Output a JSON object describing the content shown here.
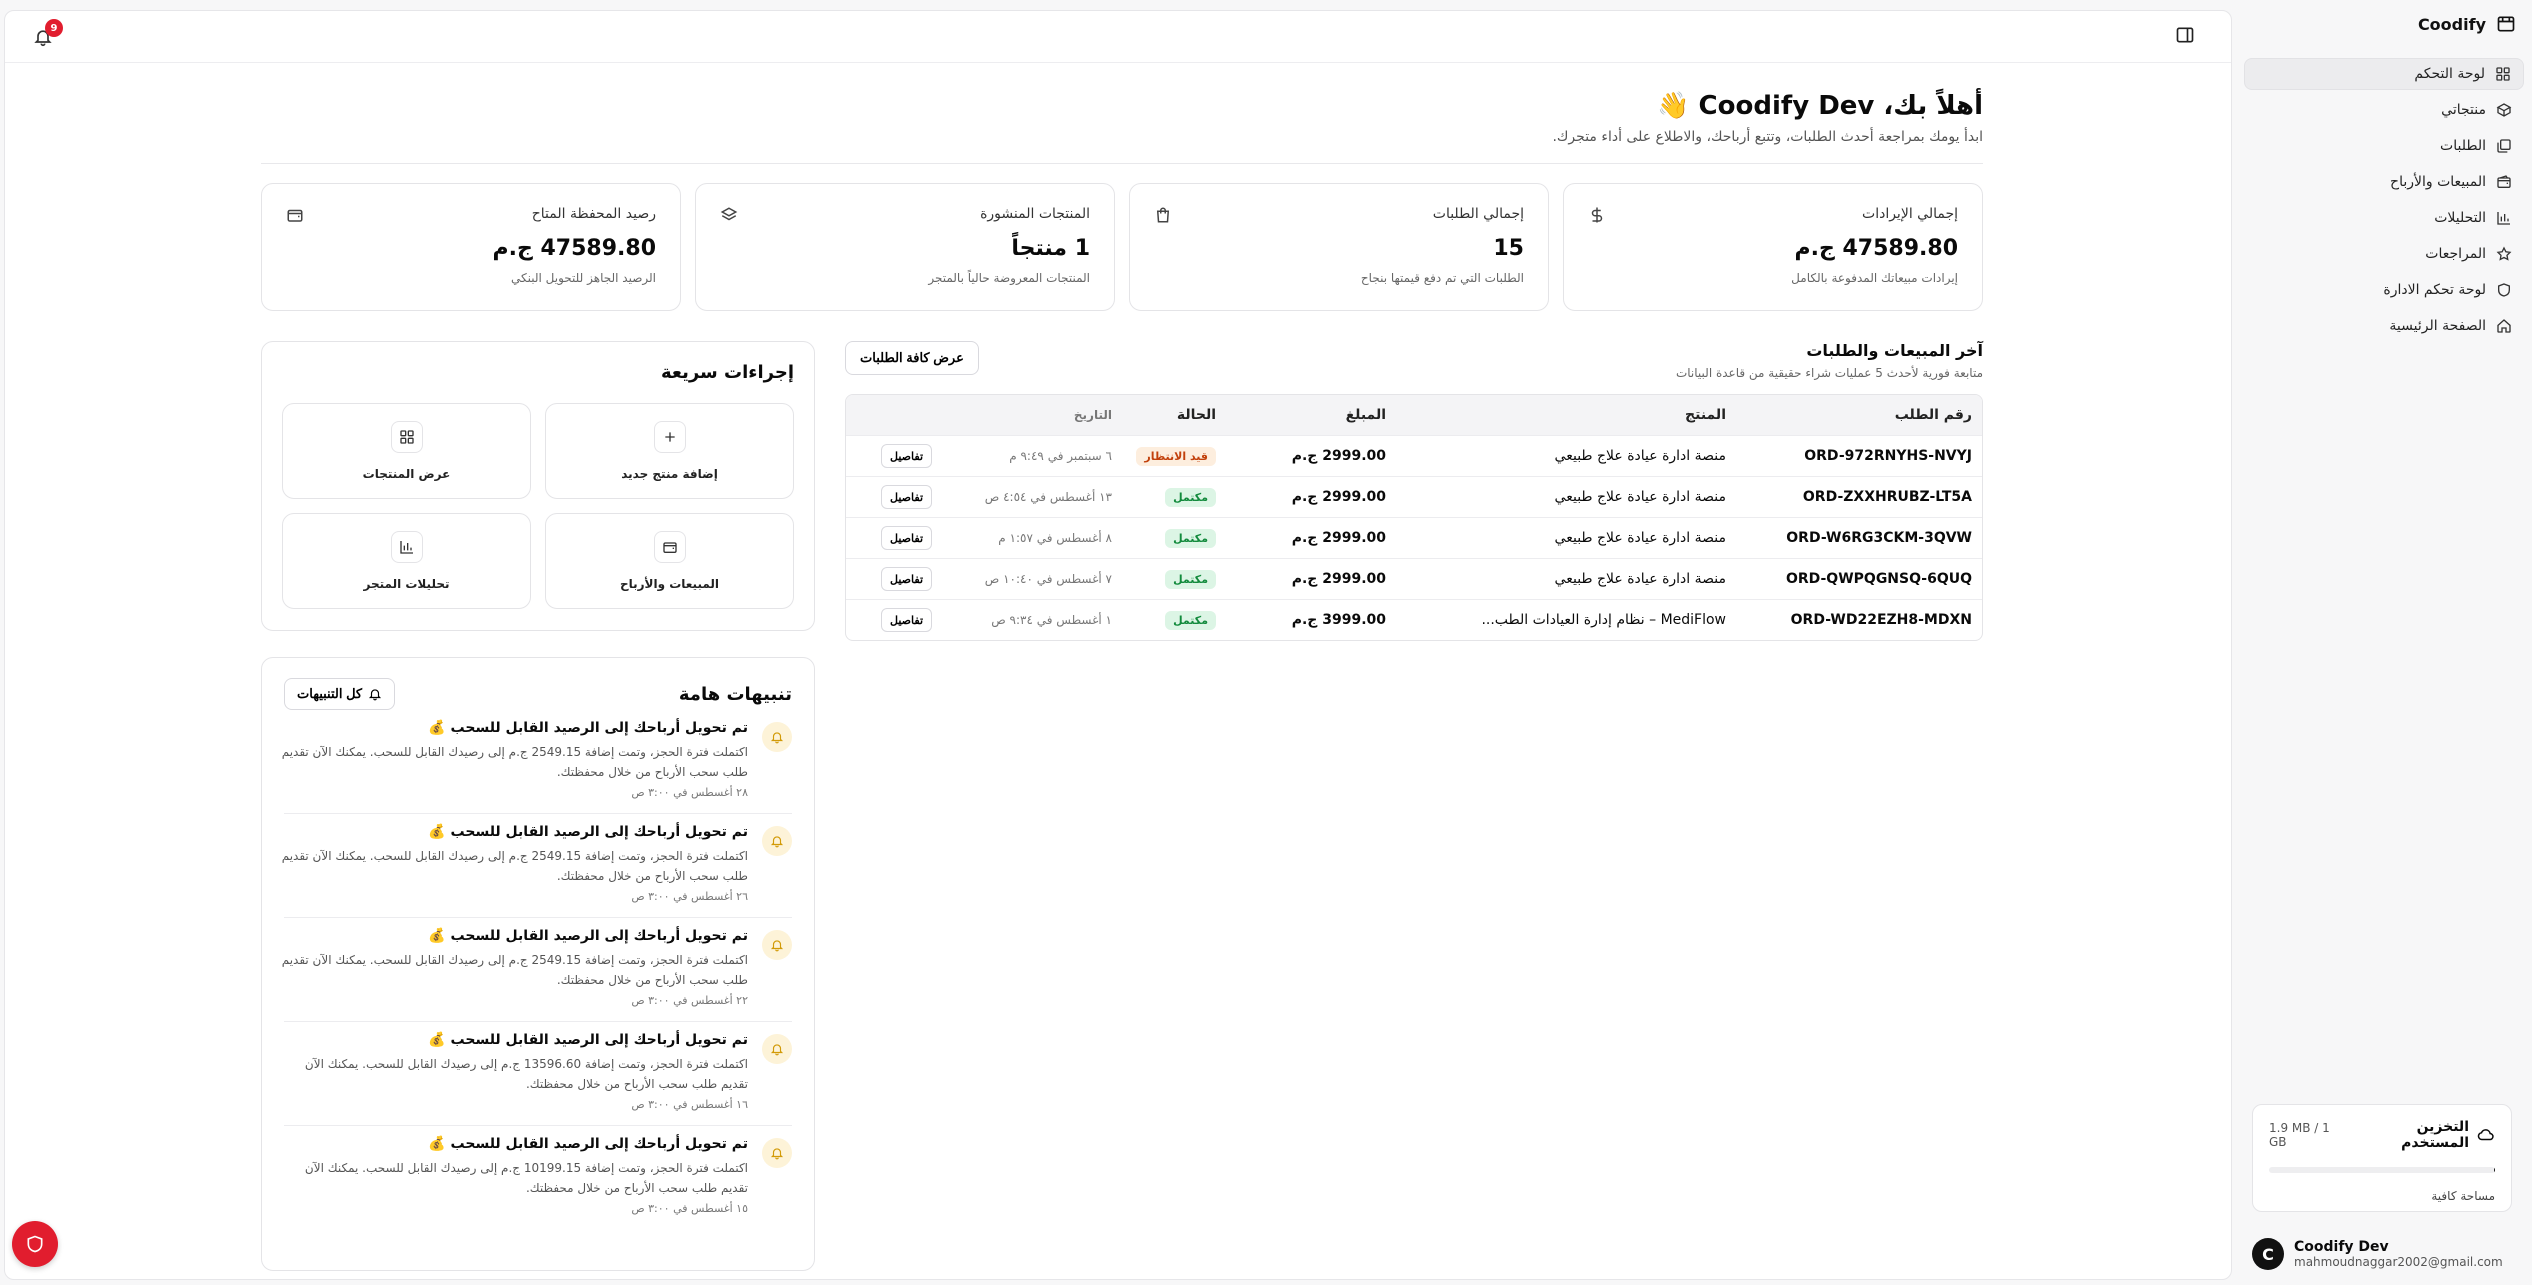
{
  "brand": {
    "name": "Coodify"
  },
  "sidebar": {
    "items": [
      {
        "label": "لوحة التحكم",
        "icon": "dashboard-grid-icon",
        "active": true
      },
      {
        "label": "منتجاتي",
        "icon": "box-icon"
      },
      {
        "label": "الطلبات",
        "icon": "orders-icon"
      },
      {
        "label": "المبيعات والأرباح",
        "icon": "wallet-icon"
      },
      {
        "label": "التحليلات",
        "icon": "bar-chart-icon"
      },
      {
        "label": "المراجعات",
        "icon": "star-icon"
      },
      {
        "label": "لوحة تحكم الادارة",
        "icon": "shield-icon"
      },
      {
        "label": "الصفحة الرئيسية",
        "icon": "home-icon"
      }
    ]
  },
  "storage": {
    "title": "التخزين المستخدم",
    "amount": "1.9 MB / 1 GB",
    "used_fraction": 0.002,
    "note": "مساحة كافية"
  },
  "user": {
    "name": "Coodify Dev",
    "email": "mahmoudnaggar2002@gmail.com",
    "initial": "C"
  },
  "topbar": {
    "notifications_count": "9"
  },
  "header": {
    "greeting": "أهلاً بك، Coodify Dev 👋",
    "subtitle": "ابدأ يومك بمراجعة أحدث الطلبات، وتتبع أرباحك، والاطلاع على أداء متجرك."
  },
  "stats": [
    {
      "label": "إجمالي الإيرادات",
      "value": "47589.80 ج.م",
      "desc": "إيرادات مبيعاتك المدفوعة بالكامل",
      "icon": "dollar-icon"
    },
    {
      "label": "إجمالي الطلبات",
      "value": "15",
      "desc": "الطلبات التي تم دفع قيمتها بنجاح",
      "icon": "shopping-bag-icon"
    },
    {
      "label": "المنتجات المنشورة",
      "value": "1 منتجاً",
      "desc": "المنتجات المعروضة حالياً بالمتجر",
      "icon": "layers-icon"
    },
    {
      "label": "رصيد المحفظة المتاح",
      "value": "47589.80 ج.م",
      "desc": "الرصيد الجاهز للتحويل البنكي",
      "icon": "wallet-icon"
    }
  ],
  "sales": {
    "title": "آخر المبيعات والطلبات",
    "subtitle": "متابعة فورية لأحدث 5 عمليات شراء حقيقية من قاعدة البيانات",
    "view_all": "عرض كافة الطلبات",
    "columns": [
      "رقم الطلب",
      "المنتج",
      "المبلغ",
      "الحالة",
      "التاريخ",
      ""
    ],
    "details_label": "تفاصيل",
    "rows": [
      {
        "id": "ORD-972RNYHS-NVYJ",
        "product": "منصة ادارة عيادة علاج طبيعي",
        "amount": "2999.00 ج.م",
        "status": "قيد الانتظار",
        "status_type": "pending",
        "date": "٦ سبتمبر في ٩:٤٩ م"
      },
      {
        "id": "ORD-ZXXHRUBZ-LT5A",
        "product": "منصة ادارة عيادة علاج طبيعي",
        "amount": "2999.00 ج.م",
        "status": "مكتمل",
        "status_type": "ok",
        "date": "١٣ أغسطس في ٤:٥٤ ص"
      },
      {
        "id": "ORD-W6RG3CKM-3QVW",
        "product": "منصة ادارة عيادة علاج طبيعي",
        "amount": "2999.00 ج.م",
        "status": "مكتمل",
        "status_type": "ok",
        "date": "٨ أغسطس في ١:٥٧ م"
      },
      {
        "id": "ORD-QWPQGNSQ-6QUQ",
        "product": "منصة ادارة عيادة علاج طبيعي",
        "amount": "2999.00 ج.م",
        "status": "مكتمل",
        "status_type": "ok",
        "date": "٧ أغسطس في ١٠:٤٠ ص"
      },
      {
        "id": "ORD-WD22EZH8-MDXN",
        "product": "MediFlow – نظام إدارة العيادات الطب...",
        "amount": "3999.00 ج.م",
        "status": "مكتمل",
        "status_type": "ok",
        "date": "١ أغسطس في ٩:٣٤ ص"
      }
    ]
  },
  "quick_actions": {
    "title": "إجراءات سريعة",
    "items": [
      {
        "label": "إضافة منتج جديد",
        "icon": "plus-icon"
      },
      {
        "label": "عرض المنتجات",
        "icon": "grid-icon"
      },
      {
        "label": "المبيعات والأرباح",
        "icon": "wallet-icon"
      },
      {
        "label": "تحليلات المتجر",
        "icon": "bar-chart-icon"
      }
    ]
  },
  "alerts": {
    "title": "تنبيهات هامة",
    "all_label": "كل التنبيهات",
    "items": [
      {
        "title": "تم تحويل أرباحك إلى الرصيد القابل للسحب 💰",
        "body": "اكتملت فترة الحجز، وتمت إضافة 2549.15 ج.م إلى رصيدك القابل للسحب. يمكنك الآن تقديم طلب سحب الأرباح من خلال محفظتك.",
        "date": "٢٨ أغسطس في ٣:٠٠ ص"
      },
      {
        "title": "تم تحويل أرباحك إلى الرصيد القابل للسحب 💰",
        "body": "اكتملت فترة الحجز، وتمت إضافة 2549.15 ج.م إلى رصيدك القابل للسحب. يمكنك الآن تقديم طلب سحب الأرباح من خلال محفظتك.",
        "date": "٢٦ أغسطس في ٣:٠٠ ص"
      },
      {
        "title": "تم تحويل أرباحك إلى الرصيد القابل للسحب 💰",
        "body": "اكتملت فترة الحجز، وتمت إضافة 2549.15 ج.م إلى رصيدك القابل للسحب. يمكنك الآن تقديم طلب سحب الأرباح من خلال محفظتك.",
        "date": "٢٢ أغسطس في ٣:٠٠ ص"
      },
      {
        "title": "تم تحويل أرباحك إلى الرصيد القابل للسحب 💰",
        "body": "اكتملت فترة الحجز، وتمت إضافة 13596.60 ج.م إلى رصيدك القابل للسحب. يمكنك الآن تقديم طلب سحب الأرباح من خلال محفظتك.",
        "date": "١٦ أغسطس في ٣:٠٠ ص"
      },
      {
        "title": "تم تحويل أرباحك إلى الرصيد القابل للسحب 💰",
        "body": "اكتملت فترة الحجز، وتمت إضافة 10199.15 ج.م إلى رصيدك القابل للسحب. يمكنك الآن تقديم طلب سحب الأرباح من خلال محفظتك.",
        "date": "١٥ أغسطس في ٣:٠٠ ص"
      }
    ]
  },
  "colors": {
    "accent": "#e11d2e",
    "success": "#128a3c",
    "warning": "#c2410c"
  }
}
